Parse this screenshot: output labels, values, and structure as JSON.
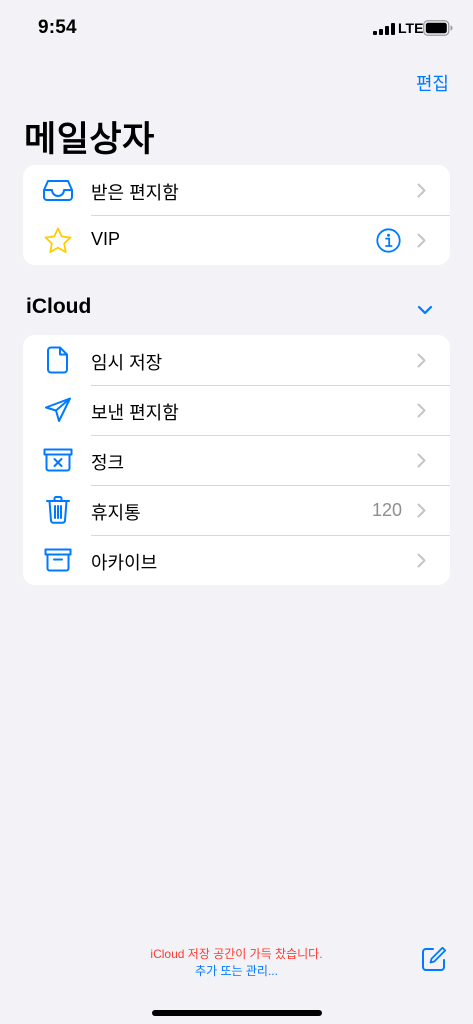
{
  "status_bar": {
    "time": "9:54",
    "network": "LTE"
  },
  "nav": {
    "edit_label": "편집",
    "title": "메일상자"
  },
  "favorites": [
    {
      "label": "받은 편지함",
      "icon": "inbox-icon"
    },
    {
      "label": "VIP",
      "icon": "star-icon"
    }
  ],
  "icloud": {
    "title": "iCloud",
    "items": [
      {
        "label": "임시 저장",
        "icon": "document-icon",
        "count": ""
      },
      {
        "label": "보낸 편지함",
        "icon": "paperplane-icon",
        "count": ""
      },
      {
        "label": "정크",
        "icon": "junk-icon",
        "count": ""
      },
      {
        "label": "휴지통",
        "icon": "trash-icon",
        "count": "120"
      },
      {
        "label": "아카이브",
        "icon": "archive-icon",
        "count": ""
      }
    ]
  },
  "footer": {
    "warning": "iCloud 저장 공간이 가득 찼습니다.",
    "link": "추가 또는 관리..."
  },
  "colors": {
    "accent": "#007aff",
    "warning": "#ff3b30",
    "star": "#ffcc00",
    "background": "#f2f2f7"
  }
}
